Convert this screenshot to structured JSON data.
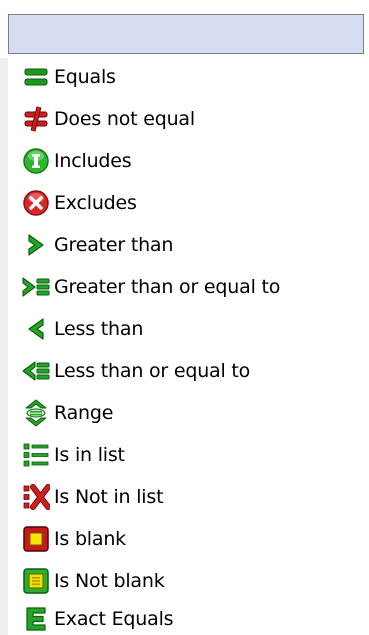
{
  "search": {
    "value": ""
  },
  "operators": [
    {
      "label": "Equals",
      "icon": "equals-icon"
    },
    {
      "label": "Does not equal",
      "icon": "not-equal-icon"
    },
    {
      "label": "Includes",
      "icon": "includes-icon"
    },
    {
      "label": "Excludes",
      "icon": "excludes-icon"
    },
    {
      "label": "Greater than",
      "icon": "greater-than-icon"
    },
    {
      "label": "Greater than or equal to",
      "icon": "greater-equal-icon"
    },
    {
      "label": "Less than",
      "icon": "less-than-icon"
    },
    {
      "label": "Less than or equal to",
      "icon": "less-equal-icon"
    },
    {
      "label": "Range",
      "icon": "range-icon"
    },
    {
      "label": "Is in list",
      "icon": "in-list-icon"
    },
    {
      "label": "Is Not in list",
      "icon": "not-in-list-icon"
    },
    {
      "label": "Is blank",
      "icon": "blank-icon"
    },
    {
      "label": "Is Not blank",
      "icon": "not-blank-icon"
    },
    {
      "label": "Exact Equals",
      "icon": "exact-equals-icon"
    }
  ],
  "colors": {
    "search_fill": "#d6ddf1",
    "green": "#22a822",
    "red": "#cc1f1f",
    "yellow": "#f5e000"
  }
}
